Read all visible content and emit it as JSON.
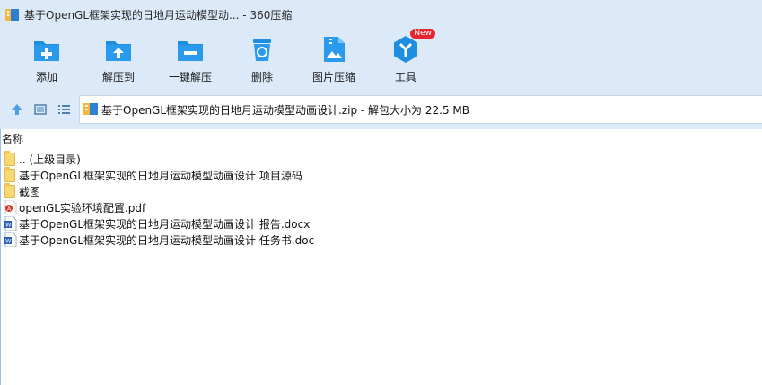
{
  "window": {
    "title": "基于OpenGL框架实现的日地月运动模型动... - 360压缩"
  },
  "toolbar": {
    "buttons": [
      {
        "label": "添加",
        "icon": "add-icon"
      },
      {
        "label": "解压到",
        "icon": "extract-to-icon"
      },
      {
        "label": "一键解压",
        "icon": "one-click-extract-icon"
      },
      {
        "label": "删除",
        "icon": "recycle-bin-icon"
      },
      {
        "label": "图片压缩",
        "icon": "image-compress-icon"
      },
      {
        "label": "工具",
        "icon": "tools-icon",
        "badge": "New"
      }
    ]
  },
  "address": {
    "path": "基于OpenGL框架实现的日地月运动模型动画设计.zip - 解包大小为 22.5 MB"
  },
  "list": {
    "column_name": "名称",
    "items": [
      {
        "name": ".. (上级目录)",
        "type": "folder"
      },
      {
        "name": "基于OpenGL框架实现的日地月运动模型动画设计 项目源码",
        "type": "folder"
      },
      {
        "name": "截图",
        "type": "folder"
      },
      {
        "name": "openGL实验环境配置.pdf",
        "type": "pdf"
      },
      {
        "name": "基于OpenGL框架实现的日地月运动模型动画设计 报告.docx",
        "type": "word"
      },
      {
        "name": "基于OpenGL框架实现的日地月运动模型动画设计 任务书.doc",
        "type": "word"
      }
    ]
  },
  "colors": {
    "chrome": "#dbe9f8",
    "icon_blue": "#1e8ee0",
    "badge_red": "#e8242d",
    "folder_yellow": "#f8d775"
  }
}
